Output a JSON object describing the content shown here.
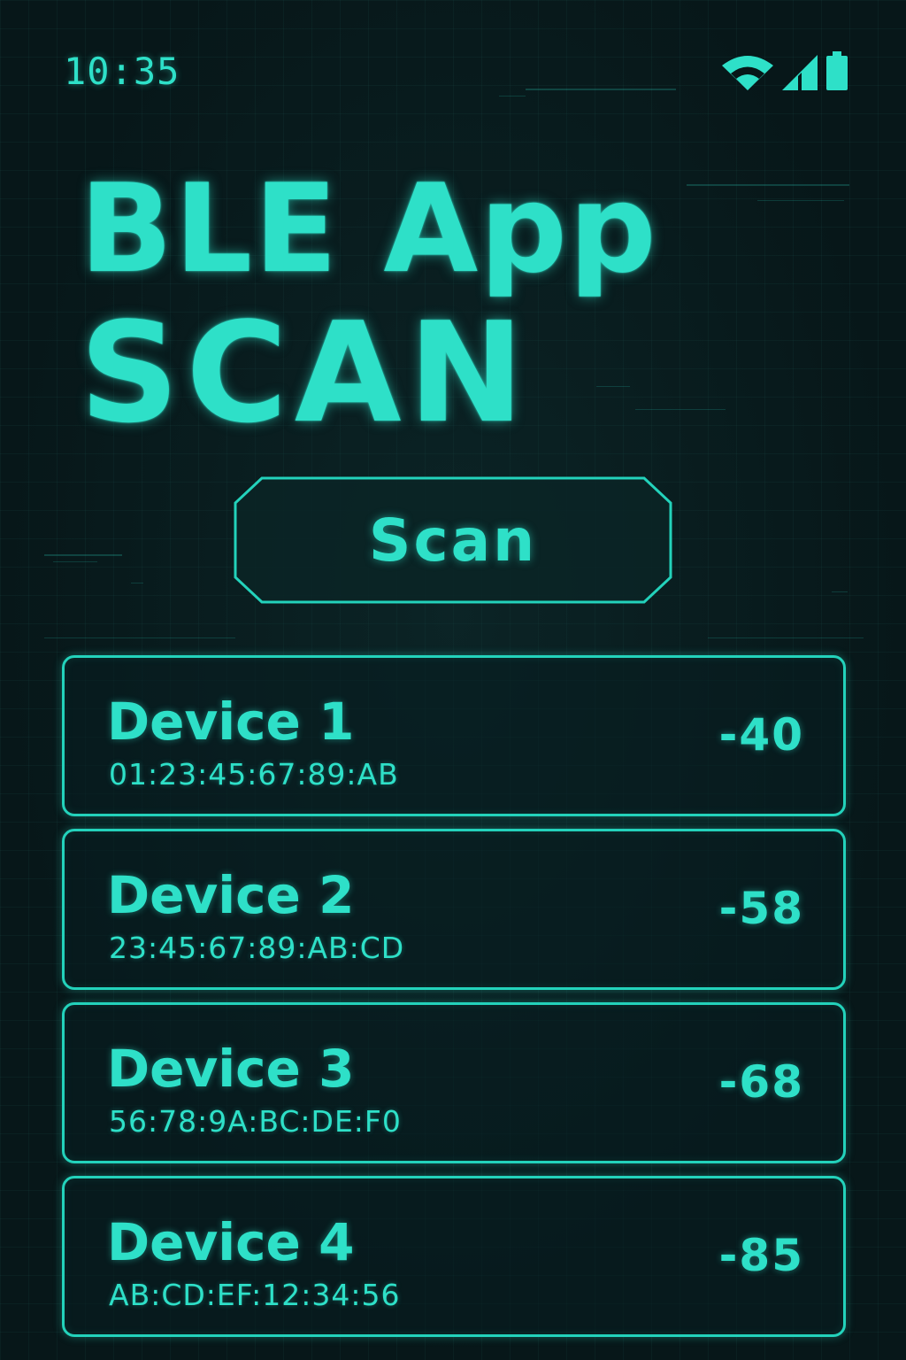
{
  "status_bar": {
    "time": "10:35",
    "icons": [
      "wifi-icon",
      "cellular-signal-icon",
      "battery-icon"
    ]
  },
  "header": {
    "title_line1": "BLE App",
    "title_line2": "SCAN"
  },
  "scan_button": {
    "label": "Scan"
  },
  "devices": [
    {
      "name": "Device 1",
      "mac": "01:23:45:67:89:AB",
      "rssi": "-40"
    },
    {
      "name": "Device 2",
      "mac": "23:45:67:89:AB:CD",
      "rssi": "-58"
    },
    {
      "name": "Device 3",
      "mac": "56:78:9A:BC:DE:F0",
      "rssi": "-68"
    },
    {
      "name": "Device 4",
      "mac": "AB:CD:EF:12:34:56",
      "rssi": "-85"
    }
  ],
  "colors": {
    "background": "#071719",
    "accent": "#2ee0c8",
    "border": "#23d2bb"
  }
}
